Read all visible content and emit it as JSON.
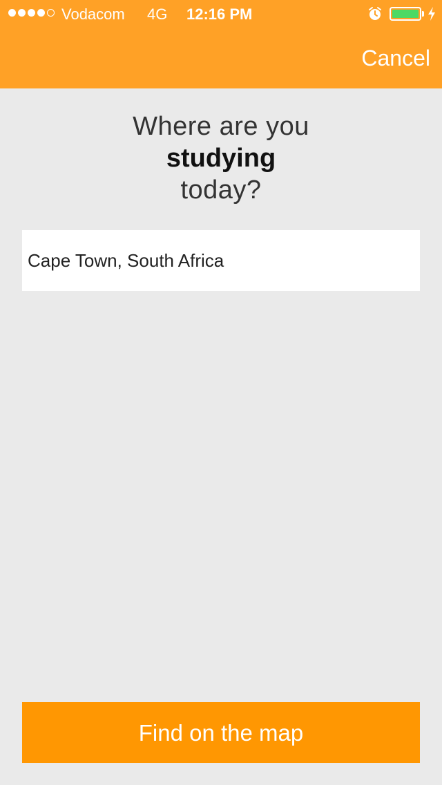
{
  "status_bar": {
    "signal_dots_filled": 4,
    "signal_dots_total": 5,
    "carrier": "Vodacom",
    "network": "4G",
    "time": "12:16 PM",
    "alarm_icon": "alarm-clock-icon",
    "battery_level": 1.0,
    "battery_color": "#4cd964",
    "charging_icon": "lightning-bolt-icon"
  },
  "header": {
    "background_color": "#ffa126",
    "cancel_label": "Cancel"
  },
  "prompt": {
    "line1": "Where are you",
    "line2": "studying",
    "line3": "today?"
  },
  "location_input": {
    "value": "Cape Town, South Africa"
  },
  "footer": {
    "button_label": "Find on the map",
    "button_color": "#ff9702"
  }
}
